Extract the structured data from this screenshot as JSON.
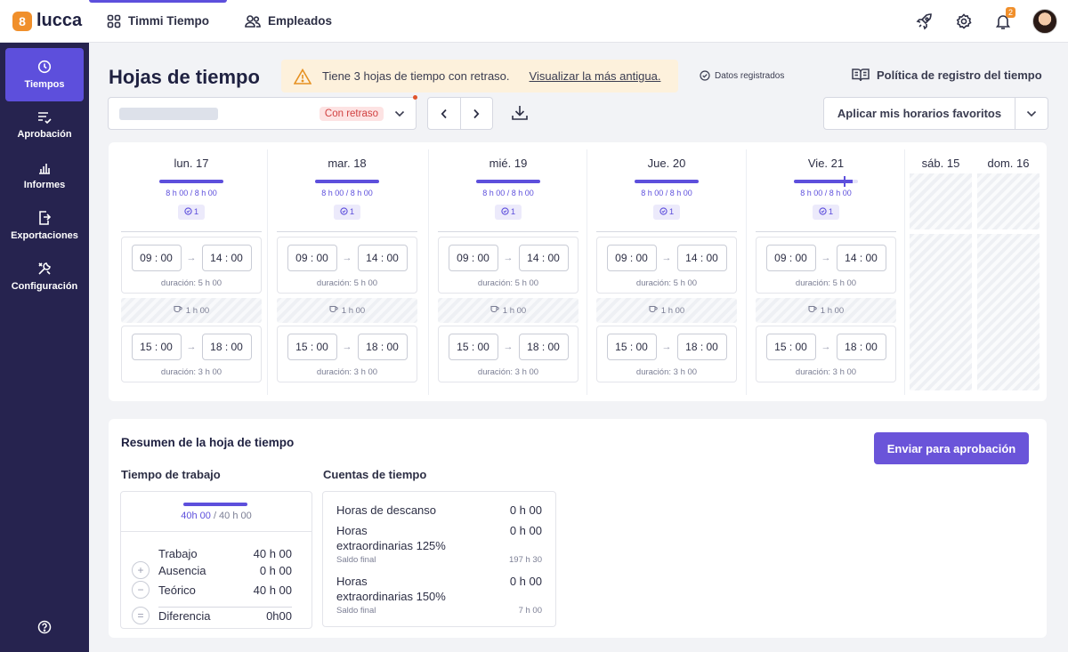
{
  "app": {
    "logo_text": "lucca"
  },
  "topnav": {
    "items": [
      {
        "label": "Timmi Tiempo"
      },
      {
        "label": "Empleados"
      }
    ],
    "notif_count": "2"
  },
  "sidebar": {
    "items": [
      {
        "label": "Tiempos"
      },
      {
        "label": "Aprobación"
      },
      {
        "label": "Informes"
      },
      {
        "label": "Exportaciones"
      },
      {
        "label": "Configuración"
      }
    ]
  },
  "header": {
    "title": "Hojas de tiempo",
    "alert_text": "Tiene 3 hojas de tiempo con retraso.",
    "alert_link": "Visualizar la más antigua.",
    "status_text": "Datos registrados",
    "policy_label": "Política de registro del tiempo"
  },
  "toolbar": {
    "select_badge": "Con retraso",
    "fav_label": "Aplicar mis horarios favoritos"
  },
  "days": [
    {
      "label": "lun. 17",
      "hours": "8 h 00  /  8 h 00",
      "pill": "1",
      "b1_start": "09 : 00",
      "b1_end": "14 : 00",
      "b1_dur": "duración: 5 h 00",
      "break": "1 h 00",
      "b2_start": "15 : 00",
      "b2_end": "18 : 00",
      "b2_dur": "duración: 3 h 00"
    },
    {
      "label": "mar. 18",
      "hours": "8 h 00  /  8 h 00",
      "pill": "1",
      "b1_start": "09 : 00",
      "b1_end": "14 : 00",
      "b1_dur": "duración: 5 h 00",
      "break": "1 h 00",
      "b2_start": "15 : 00",
      "b2_end": "18 : 00",
      "b2_dur": "duración: 3 h 00"
    },
    {
      "label": "mié. 19",
      "hours": "8 h 00  /  8 h 00",
      "pill": "1",
      "b1_start": "09 : 00",
      "b1_end": "14 : 00",
      "b1_dur": "duración: 5 h 00",
      "break": "1 h 00",
      "b2_start": "15 : 00",
      "b2_end": "18 : 00",
      "b2_dur": "duración: 3 h 00"
    },
    {
      "label": "Jue. 20",
      "hours": "8 h 00  /  8 h 00",
      "pill": "1",
      "b1_start": "09 : 00",
      "b1_end": "14 : 00",
      "b1_dur": "duración: 5 h 00",
      "break": "1 h 00",
      "b2_start": "15 : 00",
      "b2_end": "18 : 00",
      "b2_dur": "duración: 3 h 00"
    },
    {
      "label": "Vie. 21",
      "hours": "8 h 00  /  8 h 00",
      "pill": "1",
      "b1_start": "09 : 00",
      "b1_end": "14 : 00",
      "b1_dur": "duración: 5 h 00",
      "break": "1 h 00",
      "b2_start": "15 : 00",
      "b2_end": "18 : 00",
      "b2_dur": "duración: 3 h 00"
    }
  ],
  "weekend": [
    {
      "label": "sáb. 15"
    },
    {
      "label": "dom. 16"
    }
  ],
  "summary": {
    "title": "Resumen de la hoja de tiempo",
    "send_label": "Enviar para aprobación",
    "work": {
      "title": "Tiempo de trabajo",
      "hours_done": "40h 00",
      "hours_total": " / 40 h 00",
      "rows": [
        {
          "sign": "",
          "label": "Trabajo",
          "value": "40 h 00"
        },
        {
          "sign": "+",
          "label": "Ausencia",
          "value": "0 h 00"
        },
        {
          "sign": "−",
          "label": "Teórico",
          "value": "40 h 00"
        },
        {
          "sign": "=",
          "label": "Diferencia",
          "value": "0h00"
        }
      ]
    },
    "counts": {
      "title": "Cuentas de tiempo",
      "rest_label": "Horas de descanso",
      "rest_value": "0 h 00",
      "ot125_label_1": "Horas",
      "ot125_label_2": "extraordinarias 125%",
      "ot125_value": "0 h 00",
      "ot125_saldo_label": "Saldo final",
      "ot125_saldo": "197 h 30",
      "ot150_label_1": "Horas",
      "ot150_label_2": "extraordinarias 150%",
      "ot150_value": "0 h 00",
      "ot150_saldo_label": "Saldo final",
      "ot150_saldo": "7 h 00"
    }
  },
  "colors": {
    "accent": "#5d4fdc",
    "sidebar_bg": "#26234f",
    "alert_bg": "#fdf1dc",
    "late_badge": "#d14141",
    "logo": "#f08f2b"
  }
}
